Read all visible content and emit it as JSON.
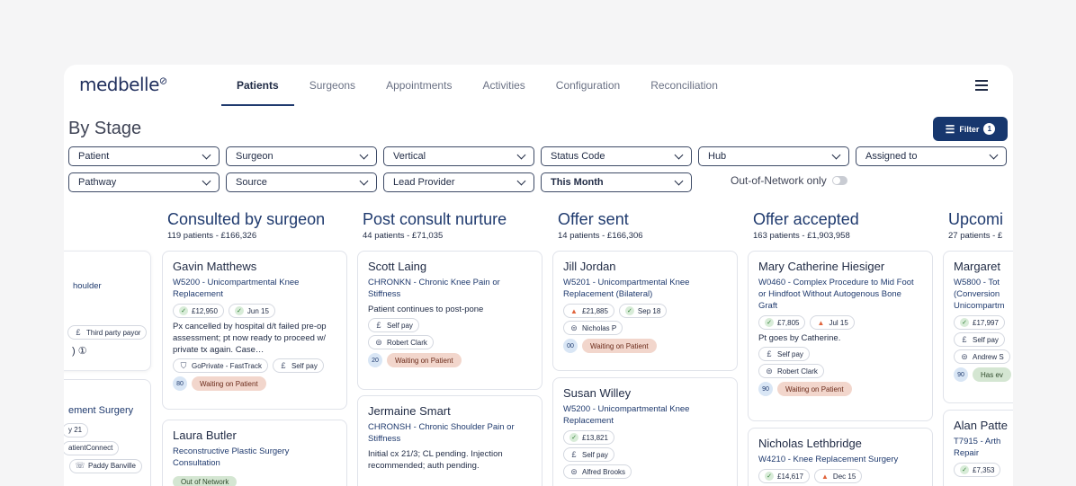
{
  "app": {
    "logo": "medbelle"
  },
  "nav": {
    "tabs": [
      "Patients",
      "Surgeons",
      "Appointments",
      "Activities",
      "Configuration",
      "Reconciliation"
    ],
    "active": "Patients"
  },
  "page": {
    "title": "By Stage"
  },
  "filter_button": {
    "label": "Filter",
    "count": "1"
  },
  "filters": {
    "row1": [
      "Patient",
      "Surgeon",
      "Vertical",
      "Status Code",
      "Hub",
      "Assigned to"
    ],
    "row2": [
      "Pathway",
      "Source",
      "Lead Provider",
      "This Month"
    ],
    "out_of_network": "Out-of-Network only"
  },
  "partial_col": {
    "card1": {
      "text": "houlder",
      "payor": "Third party payor",
      "icon": "info-circle-icon"
    },
    "card2": {
      "text": "ement Surgery",
      "date": "y 21",
      "source": "atientConnect",
      "person": "Paddy Banville"
    }
  },
  "columns": [
    {
      "title": "Consulted by surgeon",
      "subtitle": "119 patients - £166,326",
      "cards": [
        {
          "name": "Gavin Matthews",
          "proc": "W5200 - Unicompartmental Knee Replacement",
          "price": "£12,950",
          "date": "Jun 15",
          "note": "Px cancelled by hospital d/t failed pre-op assessment; pt now ready to proceed w/ private tx again. Case…",
          "provider": "GoPrivate - FastTrack",
          "pay": "Self pay",
          "num": "80",
          "status": "Waiting on Patient"
        },
        {
          "name": "Laura Butler",
          "proc": "Reconstructive Plastic Surgery Consultation",
          "tag": "Out of Network"
        }
      ]
    },
    {
      "title": "Post consult nurture",
      "subtitle": "44 patients - £71,035",
      "cards": [
        {
          "name": "Scott Laing",
          "proc": "CHRONKN - Chronic Knee Pain or Stiffness",
          "note": "Patient continues to post-pone",
          "pay": "Self pay",
          "surgeon": "Robert Clark",
          "num": "20",
          "status": "Waiting on Patient"
        },
        {
          "name": "Jermaine Smart",
          "proc": "CHRONSH - Chronic Shoulder Pain or Stiffness",
          "note": "Initial cx 21/3; CL pending. Injection recommended; auth pending."
        }
      ]
    },
    {
      "title": "Offer sent",
      "subtitle": "14 patients - £166,306",
      "cards": [
        {
          "name": "Jill Jordan",
          "proc": "W5201 - Unicompartmental Knee Replacement (Bilateral)",
          "price": "£21,885",
          "date": "Sep 18",
          "surgeon": "Nicholas P",
          "num": "00",
          "status": "Waiting on Patient"
        },
        {
          "name": "Susan Willey",
          "proc": "W5200 - Unicompartmental Knee Replacement",
          "price": "£13,821",
          "pay": "Self pay",
          "surgeon": "Alfred Brooks"
        }
      ]
    },
    {
      "title": "Offer accepted",
      "subtitle": "163 patients - £1,903,958",
      "cards": [
        {
          "name": "Mary Catherine Hiesiger",
          "proc": "W0460 - Complex Procedure to Mid Foot or Hindfoot Without Autogenous Bone Graft",
          "price": "£7,805",
          "date": "Jul 15",
          "note": "Pt goes by Catherine.",
          "pay": "Self pay",
          "surgeon": "Robert Clark",
          "num": "90",
          "status": "Waiting on Patient"
        },
        {
          "name": "Nicholas Lethbridge",
          "proc": "W4210 - Knee Replacement Surgery",
          "price": "£14,617",
          "date": "Dec 15"
        }
      ]
    },
    {
      "title": "Upcomi",
      "subtitle": "27 patients - £",
      "cards": [
        {
          "name": "Margaret",
          "proc": "W5800 - Tot (Conversion Unicompartm",
          "price": "£17,997",
          "pay": "Self pay",
          "surgeon": "Andrew S",
          "num": "90",
          "status": "Has ev"
        },
        {
          "name": "Alan Patte",
          "proc": "T7915 - Arth Repair",
          "price": "£7,353"
        }
      ]
    }
  ]
}
